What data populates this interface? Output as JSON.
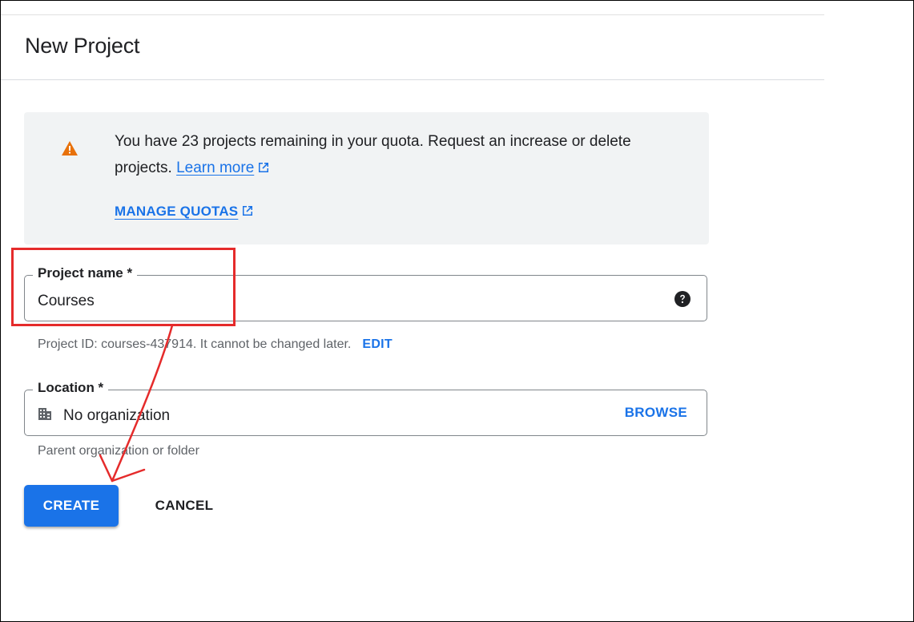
{
  "dialog": {
    "title": "New Project"
  },
  "quota_notice": {
    "message": "You have 23 projects remaining in your quota. Request an increase or delete projects.",
    "learn_more_label": "Learn more",
    "manage_quotas_label": "MANAGE QUOTAS",
    "icons": [
      "warning-icon",
      "open-in-new-icon"
    ]
  },
  "project_name": {
    "label": "Project name *",
    "value": "Courses",
    "help_icon": "help-icon",
    "id_hint": "Project ID: courses-437914. It cannot be changed later.",
    "edit_label": "EDIT"
  },
  "location": {
    "label": "Location *",
    "value": "No organization",
    "icon": "organization-icon",
    "browse_label": "BROWSE",
    "hint": "Parent organization or folder"
  },
  "actions": {
    "create_label": "CREATE",
    "cancel_label": "CANCEL"
  },
  "colors": {
    "accent": "#1a73e8",
    "warning": "#e8710a",
    "annotation": "#e52b2b",
    "notice_background": "#f1f3f4"
  }
}
